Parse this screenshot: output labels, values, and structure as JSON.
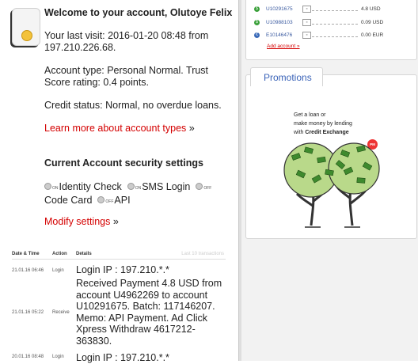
{
  "user": {
    "welcome": "Welcome to your account, Olutoye Felix",
    "last_visit": "Your last visit: 2016-01-20 08:48 from 197.210.226.68.",
    "account_type": "Account type: Personal Normal. Trust Score rating: 0.4 points.",
    "credit_status": "Credit status: Normal, no overdue loans.",
    "learn_more": "Learn more about account types",
    "raquo": "»"
  },
  "security": {
    "title": "Current Account security settings",
    "items": [
      {
        "label": "Identity Check",
        "badge": "ON"
      },
      {
        "label": "SMS Login",
        "badge": "ON"
      },
      {
        "label": "Code Card",
        "badge": "OFF"
      },
      {
        "label": "API",
        "badge": "OFF"
      }
    ],
    "modify": "Modify settings",
    "raquo": "»"
  },
  "transactions": {
    "headers": [
      "Date & Time",
      "Action",
      "Details"
    ],
    "last_label": "Last 10 transactions",
    "rows": [
      {
        "date": "21.01.16 06:46",
        "action": "Login",
        "details": "Login IP : 197.210.*.*"
      },
      {
        "date": "21.01.16 05:22",
        "action": "Receive",
        "details": "Received Payment 4.8 USD from account U4962269 to account U10291675. Batch: 117146207. Memo: API Payment. Ad Click Xpress Withdraw 4617212-363830."
      },
      {
        "date": "20.01.16 08:48",
        "action": "Login",
        "details": "Login IP : 197.210.*.*"
      }
    ]
  },
  "accounts": {
    "list": [
      {
        "number": "U10291675",
        "balance": "4.8 USD",
        "color": "#3aa03a",
        "symbol": "$"
      },
      {
        "number": "U10988103",
        "balance": "0.09 USD",
        "color": "#3aa03a",
        "symbol": "$"
      },
      {
        "number": "E10146476",
        "balance": "0.00 EUR",
        "color": "#3a6ab8",
        "symbol": "€"
      }
    ],
    "add": "Add account »"
  },
  "promo": {
    "title": "Promotions",
    "line1": "Get a loan or",
    "line2": "make money by lending",
    "line3_pre": "with ",
    "line3_bold": "Credit Exchange",
    "badge": "PM"
  }
}
